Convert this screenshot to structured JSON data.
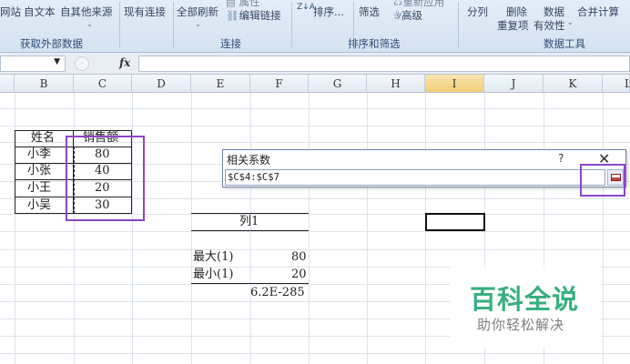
{
  "ribbon": {
    "data_buttons": [
      "网站",
      "自文本",
      "自其他来源",
      "现有连接"
    ],
    "refresh_all": "全部刷新",
    "properties": "属性",
    "edit_links": "编辑链接",
    "sort_az_icon": "Z↓A",
    "sort": "排序...",
    "filter": "筛选",
    "reapply": "重新应用",
    "advanced": "高级",
    "text_to_columns": "分列",
    "remove_line1": "删除",
    "remove_line2": "重复项",
    "data_validation_line1": "数据",
    "data_validation_line2": "有效性",
    "consolidate": "合并计算",
    "group_external": "获取外部数据",
    "group_connections": "连接",
    "group_sort_filter": "排序和筛选",
    "group_data_tools": "数据工具"
  },
  "formula_bar": {
    "fx": "fx",
    "value": ""
  },
  "columns": [
    "B",
    "C",
    "D",
    "E",
    "F",
    "G",
    "H",
    "I",
    "J",
    "K",
    "L"
  ],
  "table": {
    "header_name": "姓名",
    "header_sales": "销售额",
    "rows": [
      {
        "name": "小李",
        "sales": "80"
      },
      {
        "name": "小张",
        "sales": "40"
      },
      {
        "name": "小王",
        "sales": "20"
      },
      {
        "name": "小吴",
        "sales": "30"
      }
    ]
  },
  "stats": {
    "title": "列1",
    "max_label": "最大(1)",
    "max_value": "80",
    "min_label": "最小(1)",
    "min_value": "20",
    "extra_value": "6.2E-285"
  },
  "dialog": {
    "title": "相关系数",
    "help": "?",
    "close": "✕",
    "input_value": "$C$4:$C$7"
  },
  "watermark": {
    "title": "百科全说",
    "subtitle": "助你轻松解决"
  },
  "colors": {
    "highlight": "#8e44c9",
    "watermark_green": "#37b07f",
    "selected_column": "#f3cd75"
  }
}
